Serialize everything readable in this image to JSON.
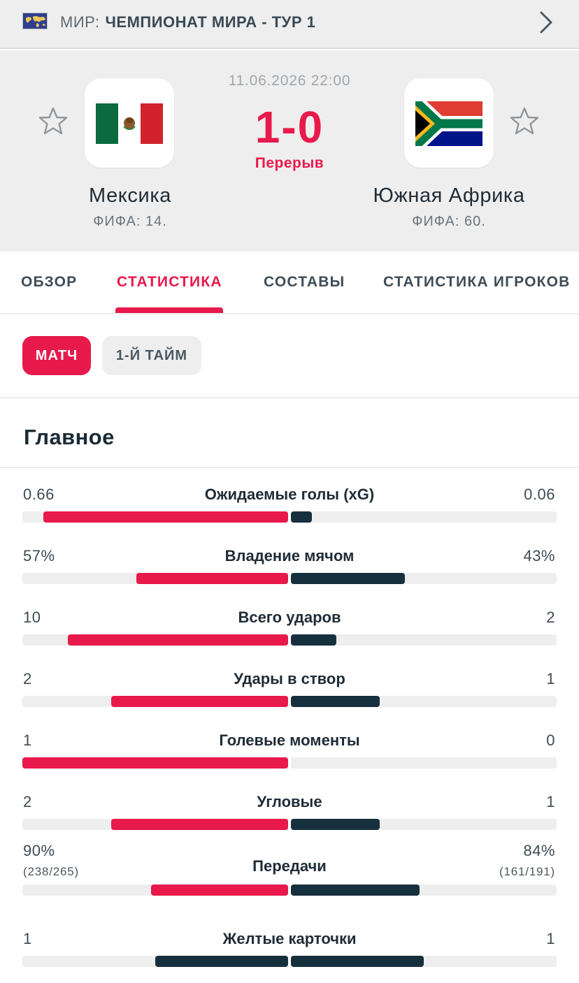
{
  "league": {
    "country": "МИР:",
    "name": "ЧЕМПИОНАТ МИРА - ТУР 1"
  },
  "match": {
    "date": "11.06.2026 22:00",
    "score": "1-0",
    "status": "Перерыв",
    "home": {
      "name": "Мексика",
      "rank": "ФИФА: 14."
    },
    "away": {
      "name": "Южная Африка",
      "rank": "ФИФА: 60."
    }
  },
  "tabs": [
    "ОБЗОР",
    "СТАТИСТИКА",
    "СОСТАВЫ",
    "СТАТИСТИКА ИГРОКОВ"
  ],
  "active_tab": "СТАТИСТИКА",
  "periods": [
    "МАТЧ",
    "1-Й ТАЙМ"
  ],
  "active_period": "МАТЧ",
  "section_title": "Главное",
  "colors": {
    "accent": "#e8194b",
    "home_bar": "#e8194b",
    "away_bar": "#17303d",
    "header_bg": "#eeeeee"
  },
  "stats": [
    {
      "label": "Ожидаемые голы (xG)",
      "home": "0.66",
      "away": "0.06",
      "home_share": 0.92,
      "away_share": 0.08
    },
    {
      "label": "Владение мячом",
      "home": "57%",
      "away": "43%",
      "home_share": 0.57,
      "away_share": 0.43
    },
    {
      "label": "Всего ударов",
      "home": "10",
      "away": "2",
      "home_share": 0.83,
      "away_share": 0.17
    },
    {
      "label": "Удары в створ",
      "home": "2",
      "away": "1",
      "home_share": 0.667,
      "away_share": 0.333
    },
    {
      "label": "Голевые моменты",
      "home": "1",
      "away": "0",
      "home_share": 1.0,
      "away_share": 0.0
    },
    {
      "label": "Угловые",
      "home": "2",
      "away": "1",
      "home_share": 0.667,
      "away_share": 0.333
    },
    {
      "label": "Передачи",
      "home": "90%",
      "away": "84%",
      "home_sub": "(238/265)",
      "away_sub": "(161/191)",
      "home_share": 0.517,
      "away_share": 0.483
    },
    {
      "label": "Желтые карточки",
      "home": "1",
      "away": "1",
      "home_share": 0.5,
      "away_share": 0.5,
      "home_color": "#17303d"
    }
  ]
}
